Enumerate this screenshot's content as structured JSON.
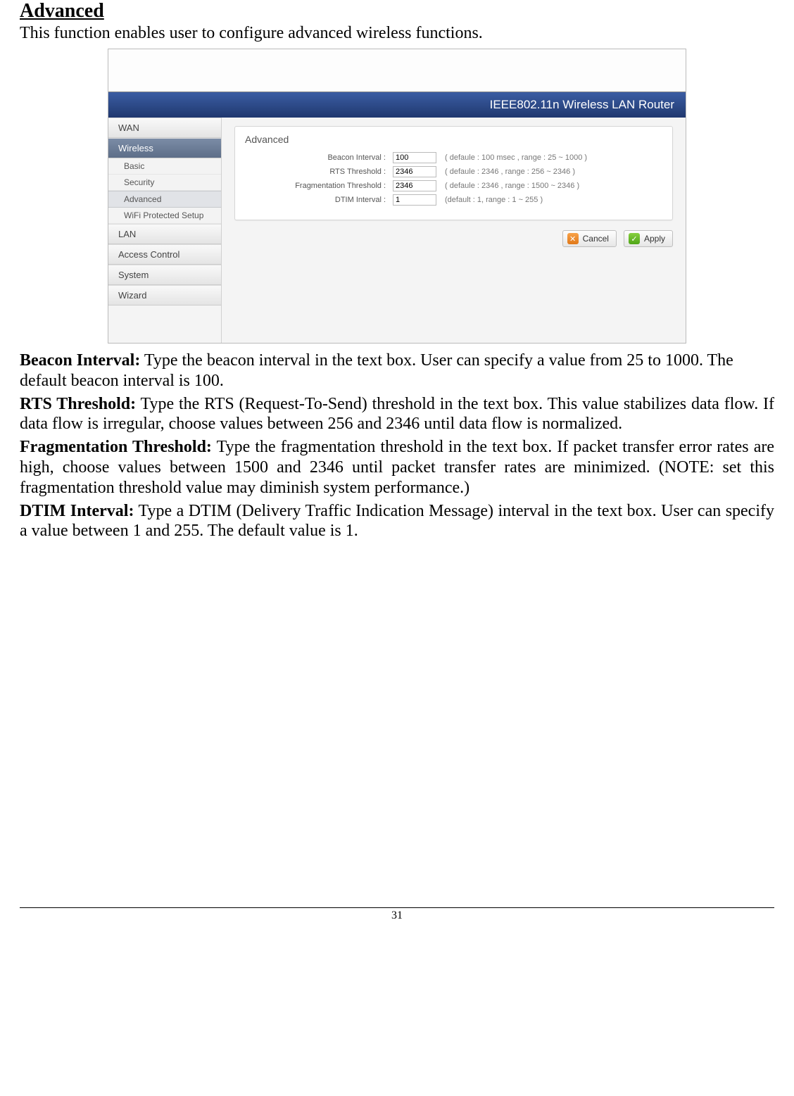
{
  "doc": {
    "heading": "Advanced",
    "intro": "This function enables user to configure advanced wireless functions.",
    "page_number": "31",
    "desc": {
      "beacon_head": "Beacon Interval:",
      "beacon_body": " Type the beacon interval in the text box. User can specify a value from 25 to 1000. The default beacon interval is 100.",
      "rts_head": "RTS Threshold:",
      "rts_body": " Type the RTS (Request-To-Send) threshold in the text box. This value stabilizes data flow. If data flow is irregular, choose values between 256 and 2346 until data flow is normalized.",
      "frag_head": "Fragmentation Threshold:",
      "frag_body": " Type the fragmentation threshold in the text box. If packet transfer error rates are high, choose values between 1500 and 2346 until packet transfer rates are minimized. (NOTE: set this fragmentation threshold value may diminish system performance.)",
      "dtim_head": "DTIM Interval:",
      "dtim_body": " Type a DTIM (Delivery Traffic Indication Message) interval in the text box. User can specify a value between 1 and 255. The default value is 1."
    }
  },
  "router": {
    "brand": "IEEE802.11n  Wireless LAN Router",
    "nav": {
      "wan": "WAN",
      "wireless": "Wireless",
      "basic": "Basic",
      "security": "Security",
      "advanced": "Advanced",
      "wps": "WiFi Protected Setup",
      "lan": "LAN",
      "access": "Access Control",
      "system": "System",
      "wizard": "Wizard"
    },
    "panel_title": "Advanced",
    "form": {
      "beacon_label": "Beacon Interval :",
      "beacon_value": "100",
      "beacon_hint": "( defaule : 100 msec , range : 25 ~ 1000 )",
      "rts_label": "RTS Threshold :",
      "rts_value": "2346",
      "rts_hint": "( defaule : 2346 , range : 256 ~ 2346 )",
      "frag_label": "Fragmentation Threshold :",
      "frag_value": "2346",
      "frag_hint": "( defaule : 2346 , range : 1500 ~ 2346 )",
      "dtim_label": "DTIM Interval :",
      "dtim_value": "1",
      "dtim_hint": "(default : 1, range : 1 ~ 255 )"
    },
    "buttons": {
      "cancel": "Cancel",
      "apply": "Apply"
    }
  }
}
